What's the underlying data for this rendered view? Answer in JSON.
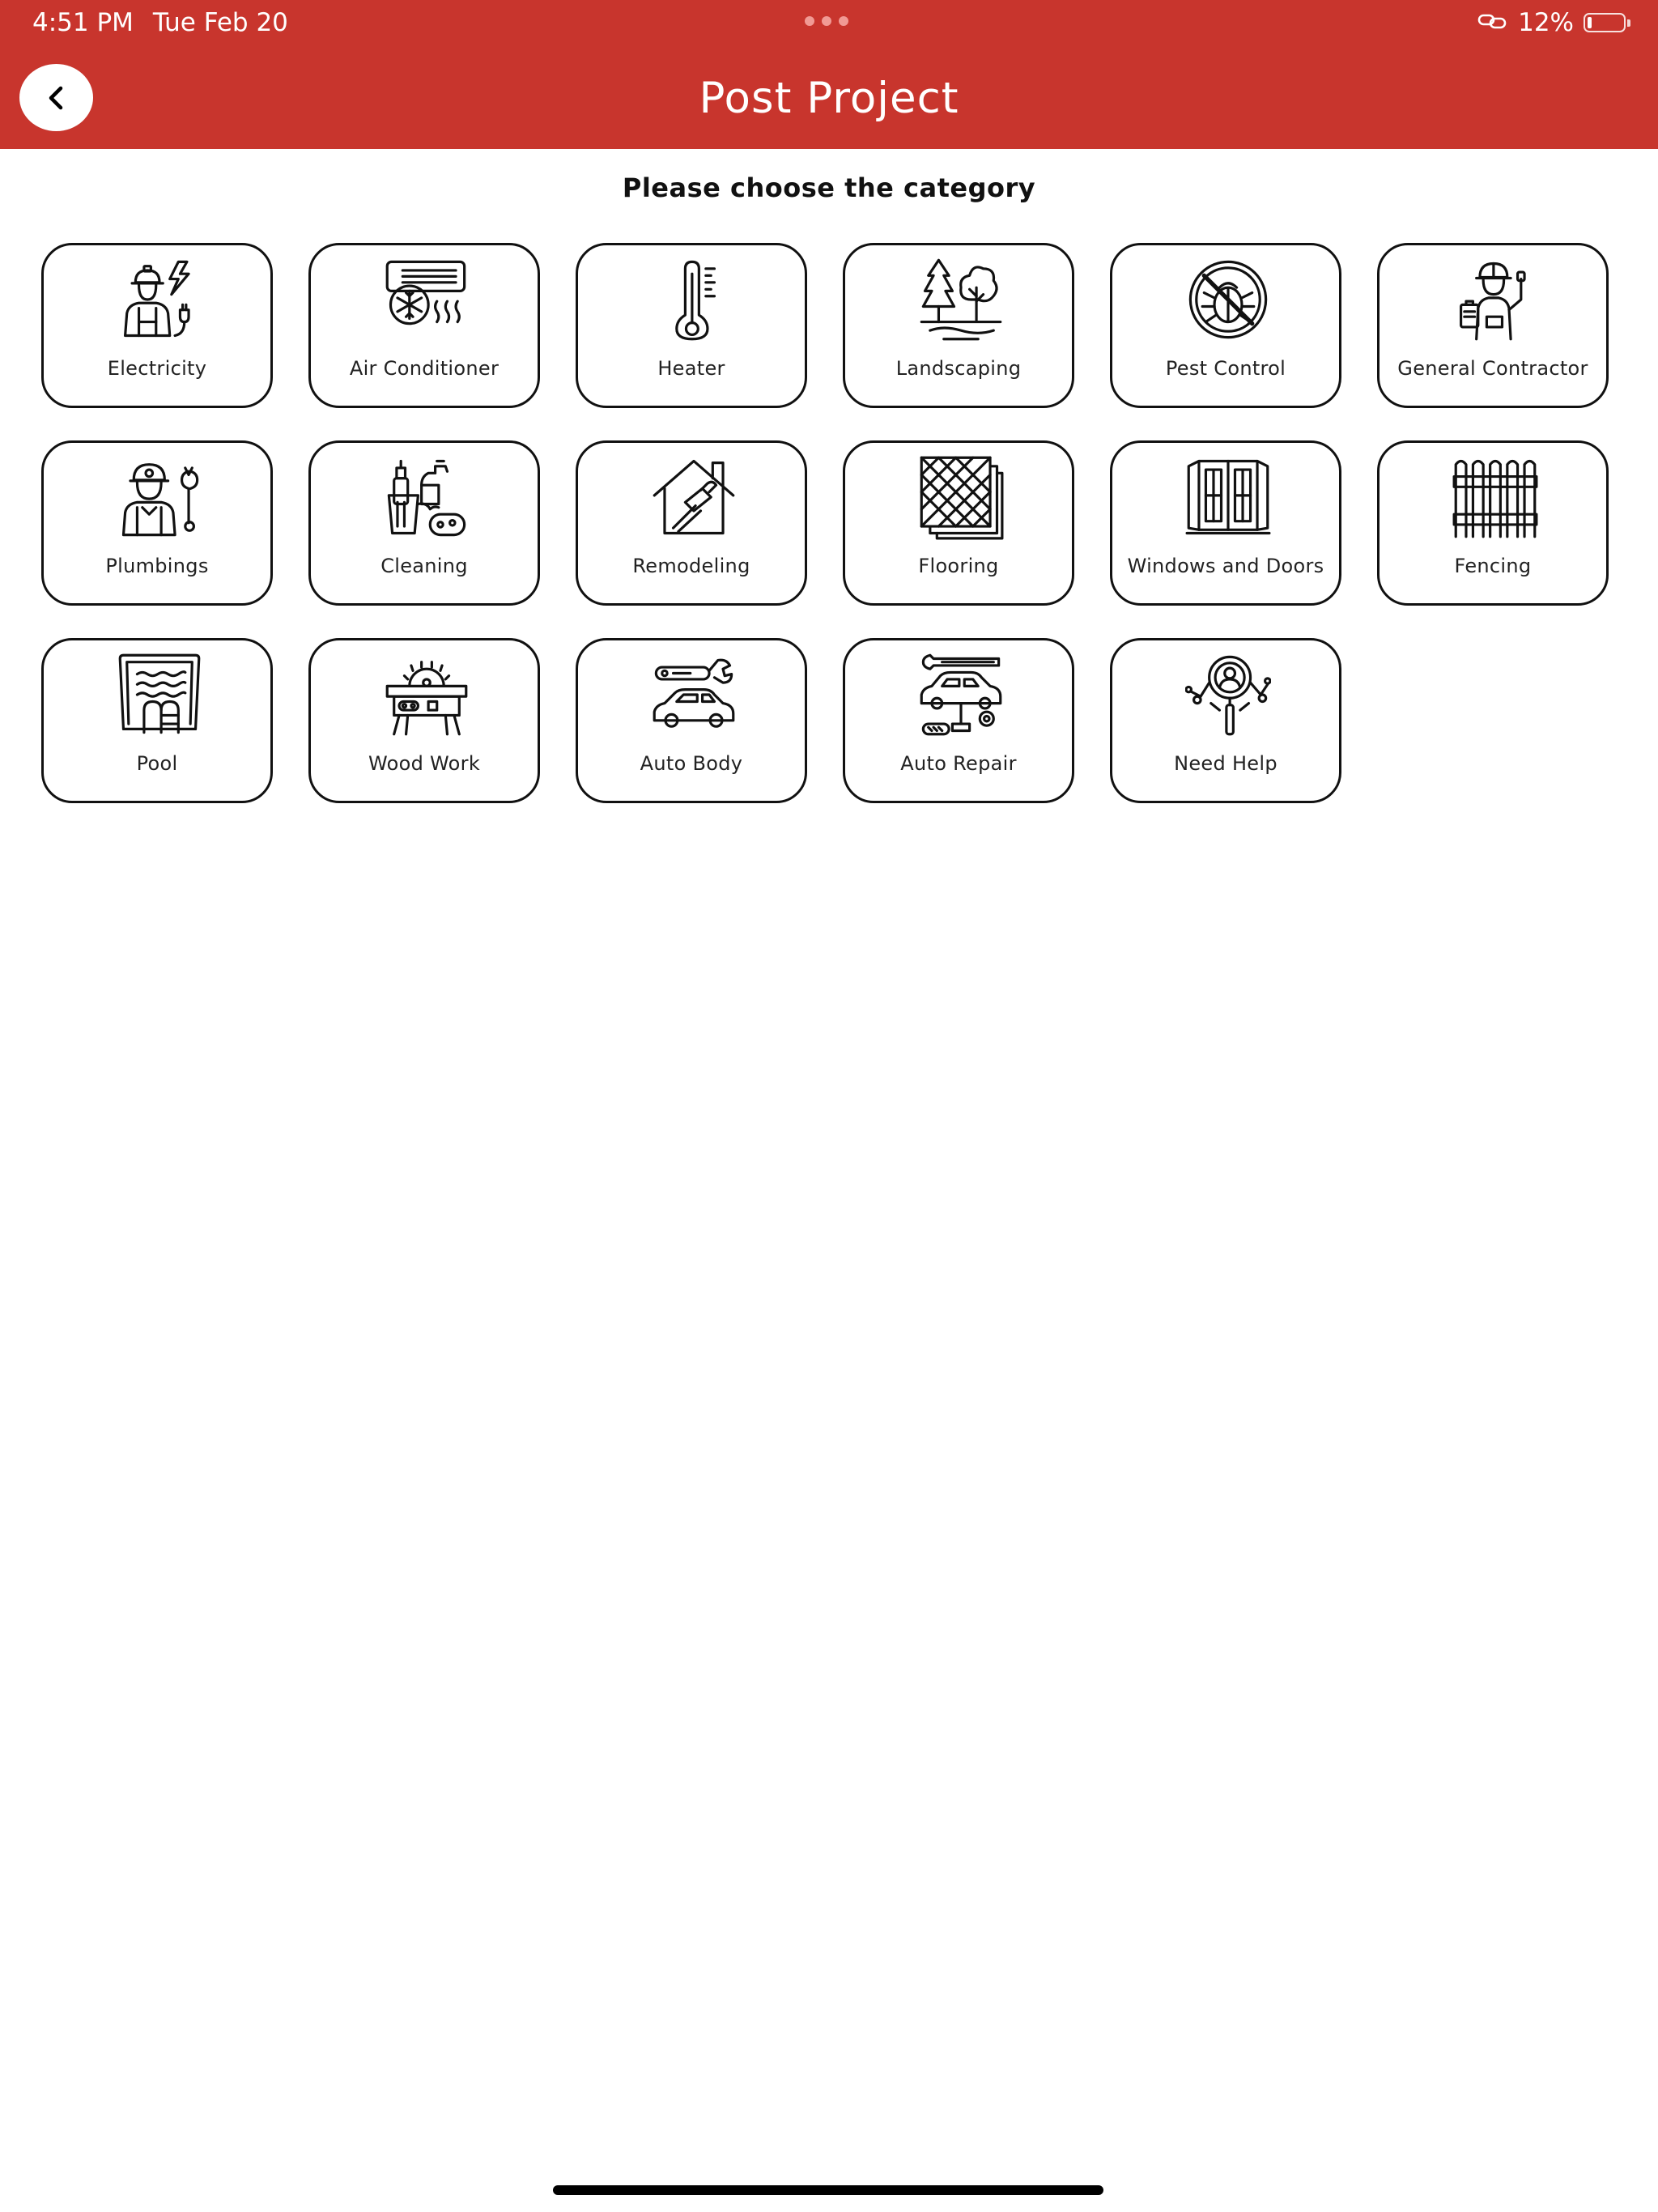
{
  "status_bar": {
    "time": "4:51 PM",
    "date": "Tue Feb 20",
    "battery": "12%",
    "battery_level": 0.12
  },
  "header": {
    "title": "Post Project",
    "background_color": "#c8352d",
    "back_icon": "chevron-left-icon"
  },
  "section_title": "Please choose the category",
  "categories": [
    {
      "label": "Electricity",
      "icon": "electrician-icon"
    },
    {
      "label": "Air Conditioner",
      "icon": "air-conditioner-icon"
    },
    {
      "label": "Heater",
      "icon": "thermometer-icon"
    },
    {
      "label": "Landscaping",
      "icon": "trees-icon"
    },
    {
      "label": "Pest Control",
      "icon": "no-bug-icon"
    },
    {
      "label": "General Contractor",
      "icon": "contractor-icon"
    },
    {
      "label": "Plumbings",
      "icon": "plumber-icon"
    },
    {
      "label": "Cleaning",
      "icon": "cleaning-supplies-icon"
    },
    {
      "label": "Remodeling",
      "icon": "house-hammer-icon"
    },
    {
      "label": "Flooring",
      "icon": "floor-tiles-icon"
    },
    {
      "label": "Windows and Doors",
      "icon": "window-door-icon"
    },
    {
      "label": "Fencing",
      "icon": "fence-icon"
    },
    {
      "label": "Pool",
      "icon": "pool-icon"
    },
    {
      "label": "Wood Work",
      "icon": "saw-table-icon"
    },
    {
      "label": "Auto Body",
      "icon": "car-wrench-icon"
    },
    {
      "label": "Auto Repair",
      "icon": "car-lift-icon"
    },
    {
      "label": "Need Help",
      "icon": "magnifier-person-icon"
    }
  ]
}
